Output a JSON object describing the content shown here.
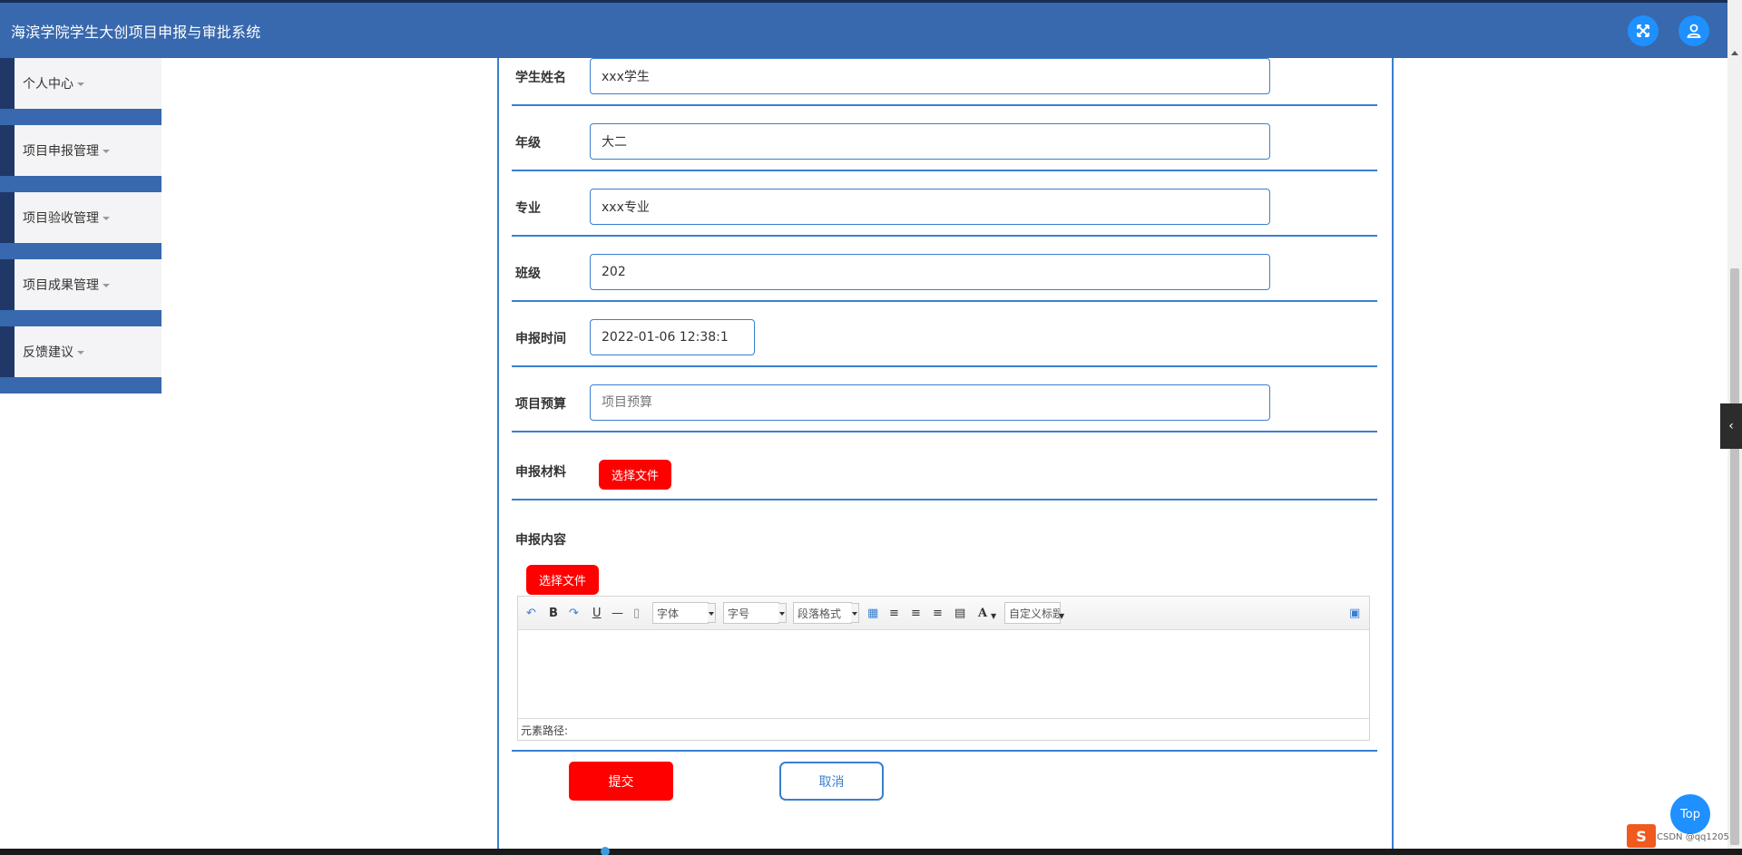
{
  "header": {
    "title": "海滨学院学生大创项目申报与审批系统"
  },
  "sidebar": {
    "items": [
      {
        "label": "个人中心"
      },
      {
        "label": "项目申报管理"
      },
      {
        "label": "项目验收管理"
      },
      {
        "label": "项目成果管理"
      },
      {
        "label": "反馈建议"
      }
    ]
  },
  "form": {
    "student_name": {
      "label": "学生姓名",
      "value": "xxx学生"
    },
    "grade": {
      "label": "年级",
      "value": "大二"
    },
    "major": {
      "label": "专业",
      "value": "xxx专业"
    },
    "class": {
      "label": "班级",
      "value": "202"
    },
    "apply_time": {
      "label": "申报时间",
      "value": "2022-01-06 12:38:1"
    },
    "budget": {
      "label": "项目预算",
      "placeholder": "项目预算"
    },
    "material": {
      "label": "申报材料",
      "button": "选择文件"
    },
    "content": {
      "label": "申报内容",
      "button": "选择文件"
    }
  },
  "editor": {
    "font_family": "字体",
    "font_size": "字号",
    "paragraph": "段落格式",
    "custom_title": "自定义标题",
    "bold": "B",
    "underline": "U",
    "font_color": "A",
    "status_path": "元素路径:"
  },
  "actions": {
    "submit": "提交",
    "cancel": "取消"
  },
  "floating": {
    "top": "Top",
    "ime": "S",
    "tray_text": "CSDN @qq1205"
  },
  "colors": {
    "header": "#3868ad",
    "accent": "#3a7fd0",
    "danger": "#ff0000",
    "round_button": "#1e90ff"
  }
}
